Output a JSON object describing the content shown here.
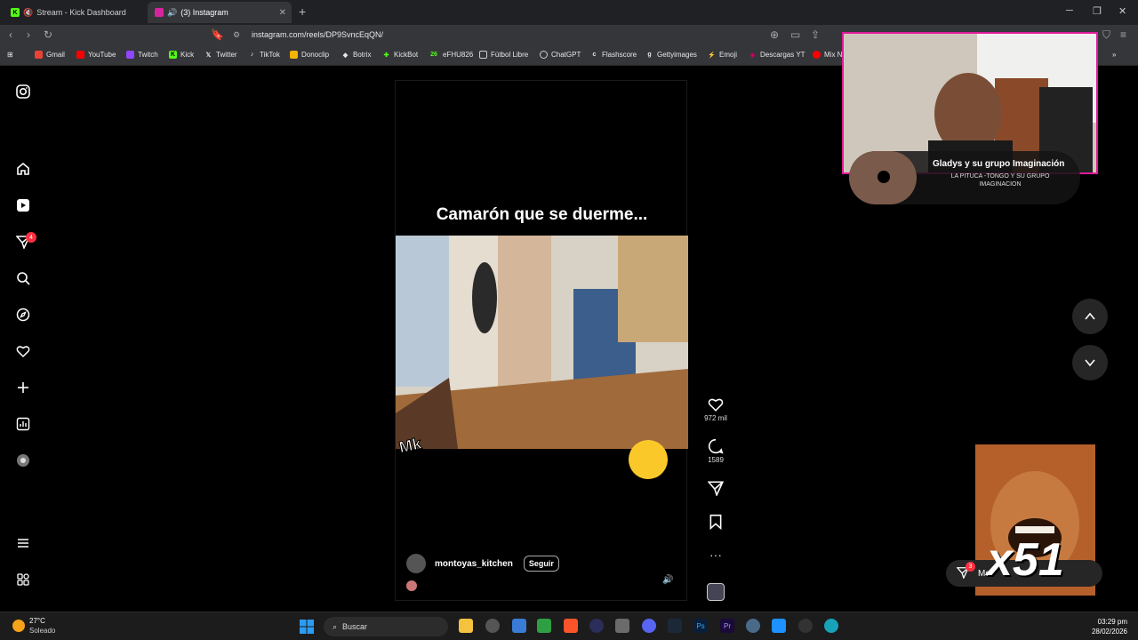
{
  "browser": {
    "tabs": [
      {
        "label": "Stream - Kick Dashboard",
        "active": false
      },
      {
        "label": "(3) Instagram",
        "active": true
      }
    ],
    "url": "instagram.com/reels/DP9SvncEqQN/",
    "bookmarks": [
      "Gmail",
      "YouTube",
      "Twitch",
      "Kick",
      "Twitter",
      "TikTok",
      "Donoclip",
      "Botrix",
      "KickBot",
      "eFHU826",
      "Fútbol Libre",
      "ChatGPT",
      "Flashscore",
      "Gettyimages",
      "Emoji",
      "Descargas YT",
      "Mix N"
    ],
    "bookmark_26": "26"
  },
  "sidebar": {
    "icons": [
      "instagram-icon",
      "home-icon",
      "reels-icon",
      "messages-icon",
      "search-icon",
      "explore-icon",
      "notifications-icon",
      "create-icon",
      "dashboard-icon",
      "profile-icon",
      "menu-icon",
      "more-icon"
    ],
    "messages_badge": "4"
  },
  "reel": {
    "caption": "Camarón que se duerme...",
    "watermark": "Mk",
    "username": "montoyas_kitchen",
    "follow_label": "Seguir",
    "likes": "972 mil",
    "comments": "1589"
  },
  "overlay": {
    "song_title": "Gladys y su grupo Imaginación",
    "song_sub": "LA PITUCA -TONGO Y SU GRUPO IMAGINACION",
    "multiplier": "x51",
    "msg_badge": "3",
    "msg_label": "Me"
  },
  "taskbar": {
    "temp": "27°C",
    "weather": "Soleado",
    "search_placeholder": "Buscar",
    "time": "03:29 pm",
    "date": "28/02/2026"
  },
  "colors": {
    "badge": "#ff3040",
    "stream_border": "#e01a9a",
    "kick_green": "#53fc18"
  }
}
